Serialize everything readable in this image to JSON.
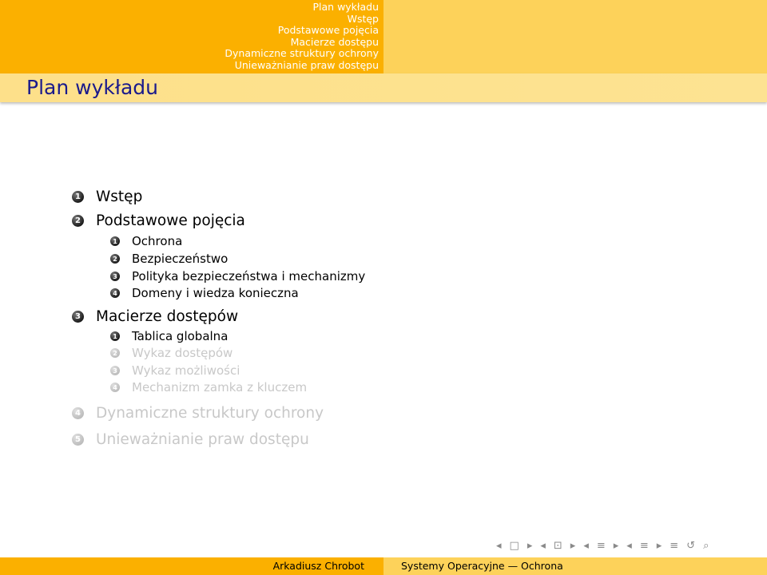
{
  "header": {
    "nav_items": [
      "Plan wykładu",
      "Wstęp",
      "Podstawowe pojęcia",
      "Macierze dostępu",
      "Dynamiczne struktury ochrony",
      "Unieważnianie praw dostępu"
    ],
    "frame_title": "Plan wykładu"
  },
  "outline": {
    "sections": [
      {
        "number": "1",
        "label": "Wstęp"
      },
      {
        "number": "2",
        "label": "Podstawowe pojęcia"
      },
      {
        "number": "3",
        "label": "Macierze dostępów"
      },
      {
        "number": "4",
        "label": "Dynamiczne struktury ochrony"
      },
      {
        "number": "5",
        "label": "Unieważnianie praw dostępu"
      }
    ],
    "sub_section_2": [
      {
        "number": "1",
        "label": "Ochrona"
      },
      {
        "number": "2",
        "label": "Bezpieczeństwo"
      },
      {
        "number": "3",
        "label": "Polityka bezpieczeństwa i mechanizmy"
      },
      {
        "number": "4",
        "label": "Domeny i wiedza konieczna"
      }
    ],
    "sub_section_3": [
      {
        "number": "1",
        "label": "Tablica globalna"
      },
      {
        "number": "2",
        "label": "Wykaz dostępów"
      },
      {
        "number": "3",
        "label": "Wykaz możliwości"
      },
      {
        "number": "4",
        "label": "Mechanizm zamka z kluczem"
      }
    ]
  },
  "nav_controls": {
    "symbols": [
      "◂",
      "□",
      "▸",
      "◂",
      "⊡",
      "▸",
      "◂",
      "≡",
      "▸",
      "◂",
      "≡",
      "▸",
      "≡",
      "↺",
      "⌕"
    ]
  },
  "footer": {
    "author": "Arkadiusz Chrobot",
    "course": "Systemy Operacyjne — Ochrona"
  }
}
